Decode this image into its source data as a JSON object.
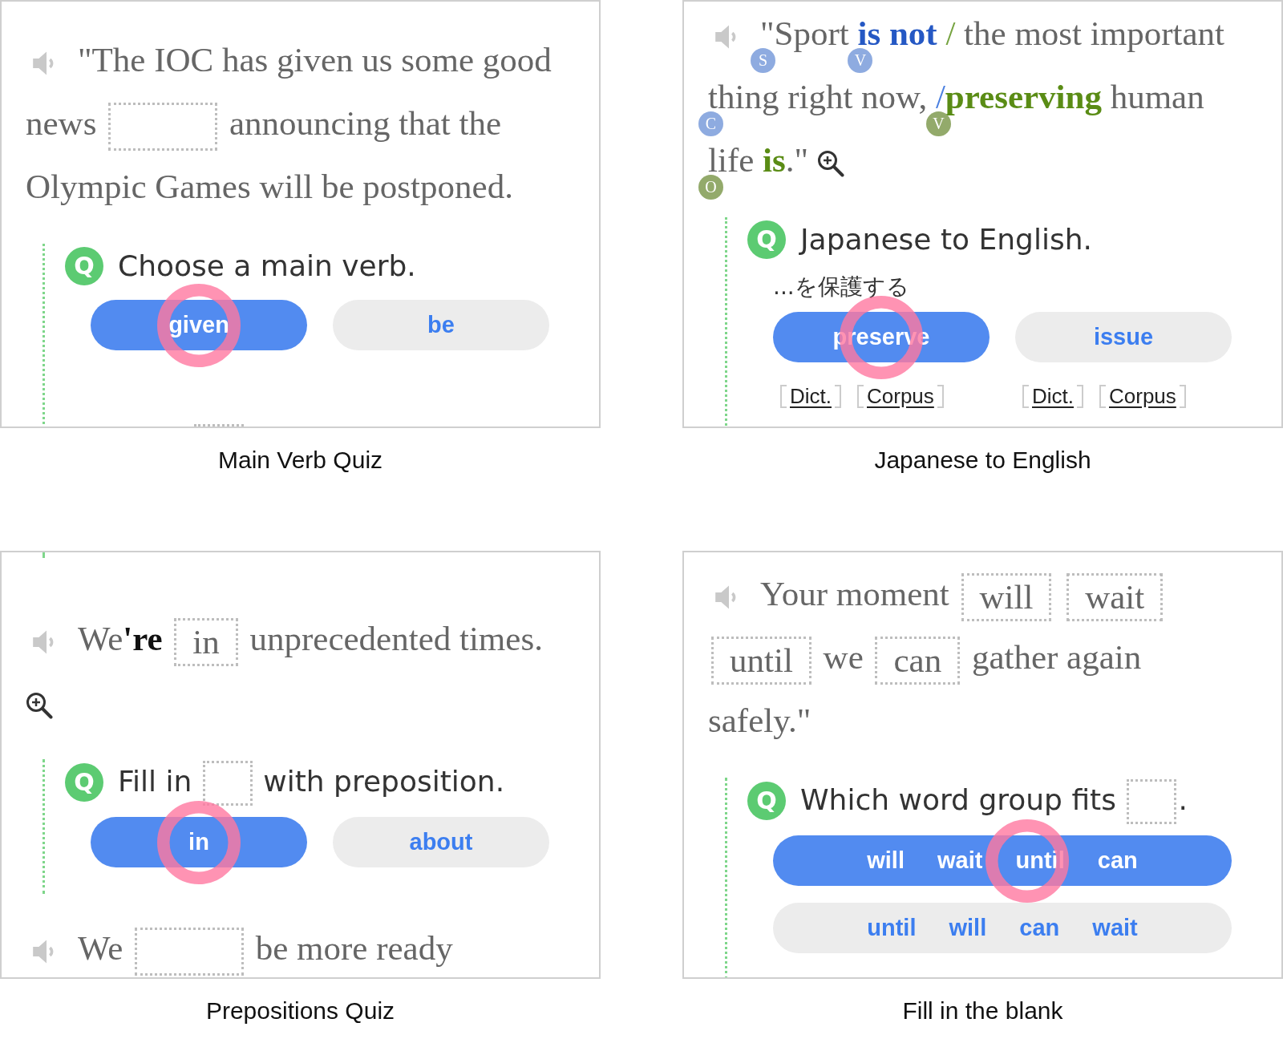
{
  "panels": [
    {
      "caption": "Main Verb Quiz",
      "blocks": [
        {
          "kind": "sentence",
          "speaker": true,
          "parts": [
            {
              "kind": "text",
              "text": "\"The IOC has given us some good"
            },
            {
              "kind": "text",
              "text": "news"
            },
            {
              "kind": "blank"
            },
            {
              "kind": "text",
              "text": "announcing that the"
            },
            {
              "kind": "text",
              "text": "Olympic Games will be postponed."
            }
          ]
        },
        {
          "kind": "question",
          "badge": "Q",
          "prompt": [
            {
              "kind": "text",
              "text": "Choose a main verb."
            }
          ],
          "options": [
            {
              "label": "given",
              "selected": true
            },
            {
              "label": "be",
              "selected": false
            }
          ]
        },
        {
          "kind": "cut_blank"
        }
      ]
    },
    {
      "caption": "Japanese to English",
      "blocks": [
        {
          "kind": "sentence",
          "speaker": true,
          "zoom": true,
          "parts": [
            {
              "kind": "text",
              "text": "\"Sport",
              "badge": {
                "label": "S",
                "color": "#8eabe0"
              }
            },
            {
              "kind": "text",
              "text": "is not",
              "color": "#2558c4",
              "badge": {
                "label": "V",
                "color": "#8eabe0"
              }
            },
            {
              "kind": "slash",
              "text": "/",
              "color": "#76a340"
            },
            {
              "kind": "text",
              "text": "the most important"
            },
            {
              "kind": "text",
              "text": "thing",
              "badge": {
                "label": "C",
                "color": "#8eabe0"
              }
            },
            {
              "kind": "text",
              "text": "right now,"
            },
            {
              "kind": "slash",
              "text": "/",
              "color": "#4a7fe0",
              "badge": {
                "label": "V",
                "color": "#93aa6b"
              }
            },
            {
              "kind": "text",
              "text": "preserving",
              "color": "#5a8c15",
              "tight": true
            },
            {
              "kind": "text",
              "text": "human"
            },
            {
              "kind": "text",
              "text": "life",
              "badge": {
                "label": "O",
                "color": "#93aa6b"
              }
            },
            {
              "kind": "text",
              "text": "is",
              "color": "#5a8c15"
            },
            {
              "kind": "text",
              "text": ".\"",
              "tight": true
            }
          ]
        },
        {
          "kind": "question",
          "badge": "Q",
          "prompt": [
            {
              "kind": "text",
              "text": "Japanese to English."
            }
          ],
          "hint": "...を保護する",
          "options": [
            {
              "label": "preserve",
              "selected": true,
              "links": [
                "Dict.",
                "Corpus"
              ]
            },
            {
              "label": "issue",
              "selected": false,
              "links": [
                "Dict.",
                "Corpus"
              ]
            }
          ]
        }
      ]
    },
    {
      "caption": "Prepositions Quiz",
      "blocks": [
        {
          "kind": "question_tail"
        },
        {
          "kind": "sentence",
          "speaker": true,
          "zoom": true,
          "parts": [
            {
              "kind": "text",
              "text": "We**'re**"
            },
            {
              "kind": "blank",
              "value": "in"
            },
            {
              "kind": "text",
              "text": "unprecedented times."
            }
          ]
        },
        {
          "kind": "question",
          "badge": "Q",
          "prompt": [
            {
              "kind": "text",
              "text": "Fill in"
            },
            {
              "kind": "blank"
            },
            {
              "kind": "text",
              "text": "with preposition."
            }
          ],
          "options": [
            {
              "label": "in",
              "selected": true
            },
            {
              "label": "about",
              "selected": false
            }
          ]
        },
        {
          "kind": "sentence",
          "speaker": true,
          "parts": [
            {
              "kind": "text",
              "text": "We"
            },
            {
              "kind": "blank"
            },
            {
              "kind": "text",
              "text": "be more ready"
            }
          ]
        }
      ]
    },
    {
      "caption": "Fill in the blank",
      "blocks": [
        {
          "kind": "sentence",
          "speaker": true,
          "parts": [
            {
              "kind": "text",
              "text": "Your moment"
            },
            {
              "kind": "blank",
              "value": "will"
            },
            {
              "kind": "blank",
              "value": "wait"
            },
            {
              "kind": "blank",
              "value": "until"
            },
            {
              "kind": "text",
              "text": "we"
            },
            {
              "kind": "blank",
              "value": "can"
            },
            {
              "kind": "text",
              "text": "gather again"
            },
            {
              "kind": "text",
              "text": "safely.\""
            }
          ]
        },
        {
          "kind": "question",
          "badge": "Q",
          "prompt": [
            {
              "kind": "text",
              "text": "Which word group fits"
            },
            {
              "kind": "blank"
            },
            {
              "kind": "text",
              "text": ".",
              "tight": true
            }
          ],
          "options": [
            {
              "words": [
                "will",
                "wait",
                "until",
                "can"
              ],
              "selected": true
            },
            {
              "words": [
                "until",
                "will",
                "can",
                "wait"
              ],
              "selected": false
            }
          ]
        }
      ]
    }
  ]
}
